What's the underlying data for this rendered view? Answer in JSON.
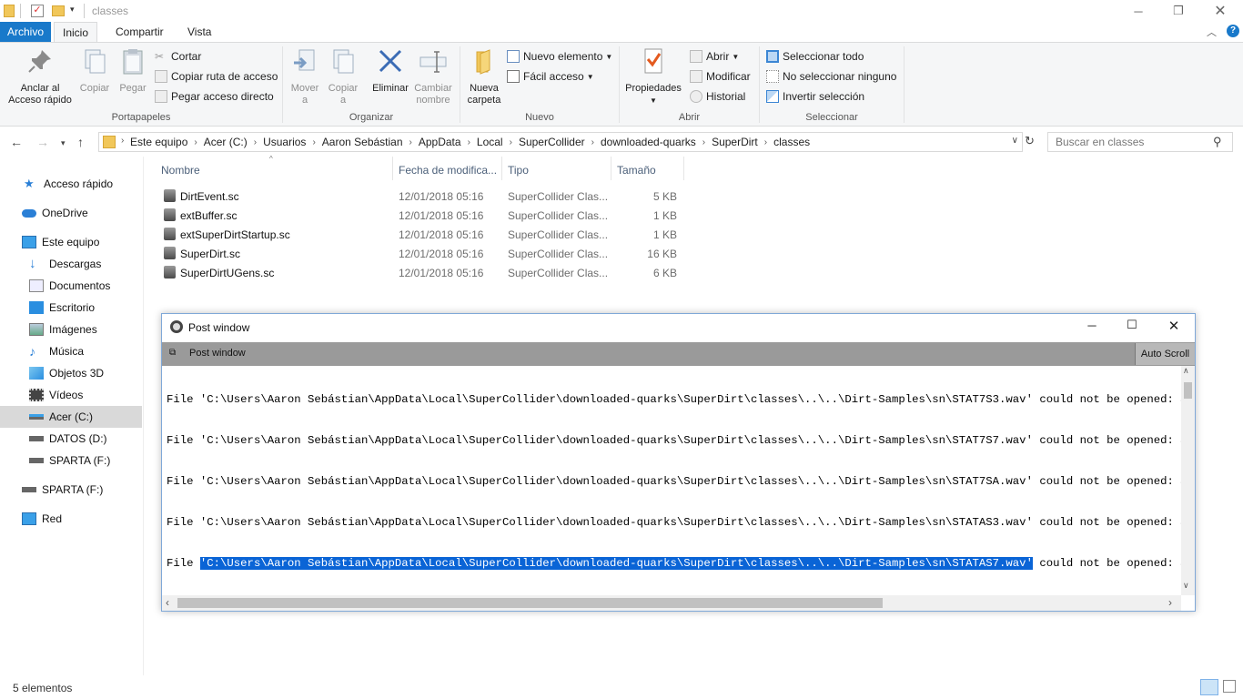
{
  "window": {
    "title": "classes"
  },
  "ribbon_tabs": [
    "Archivo",
    "Inicio",
    "Compartir",
    "Vista"
  ],
  "ribbon": {
    "portapapeles": {
      "label": "Portapapeles",
      "anclar": "Anclar al\nAcceso rápido",
      "copiar": "Copiar",
      "pegar": "Pegar",
      "cortar": "Cortar",
      "copiar_ruta": "Copiar ruta de acceso",
      "pegar_acceso": "Pegar acceso directo"
    },
    "organizar": {
      "label": "Organizar",
      "mover": "Mover\na",
      "copiar": "Copiar\na",
      "eliminar": "Eliminar",
      "cambiar": "Cambiar\nnombre"
    },
    "nuevo": {
      "label": "Nuevo",
      "nueva_carpeta": "Nueva\ncarpeta",
      "nuevo_elemento": "Nuevo elemento",
      "facil_acceso": "Fácil acceso"
    },
    "abrir": {
      "label": "Abrir",
      "propiedades": "Propiedades",
      "abrir": "Abrir",
      "modificar": "Modificar",
      "historial": "Historial"
    },
    "seleccionar": {
      "label": "Seleccionar",
      "todo": "Seleccionar todo",
      "ninguno": "No seleccionar ninguno",
      "invertir": "Invertir selección"
    }
  },
  "breadcrumb": [
    "Este equipo",
    "Acer (C:)",
    "Usuarios",
    "Aaron Sebástian",
    "AppData",
    "Local",
    "SuperCollider",
    "downloaded-quarks",
    "SuperDirt",
    "classes"
  ],
  "search": {
    "placeholder": "Buscar en classes"
  },
  "navpane": [
    {
      "label": "Acceso rápido",
      "icon": "star-icon"
    },
    {
      "label": "OneDrive",
      "icon": "cloud-icon"
    },
    {
      "label": "Este equipo",
      "icon": "computer-icon"
    },
    {
      "label": "Descargas",
      "icon": "download-icon"
    },
    {
      "label": "Documentos",
      "icon": "documents-icon"
    },
    {
      "label": "Escritorio",
      "icon": "desktop-icon"
    },
    {
      "label": "Imágenes",
      "icon": "images-icon"
    },
    {
      "label": "Música",
      "icon": "music-icon"
    },
    {
      "label": "Objetos 3D",
      "icon": "cube-icon"
    },
    {
      "label": "Vídeos",
      "icon": "video-icon"
    },
    {
      "label": "Acer (C:)",
      "icon": "drive-icon"
    },
    {
      "label": "DATOS (D:)",
      "icon": "drive-icon"
    },
    {
      "label": "SPARTA (F:)",
      "icon": "usb-drive-icon"
    },
    {
      "label": "SPARTA (F:)",
      "icon": "usb-drive-icon"
    },
    {
      "label": "Red",
      "icon": "network-icon"
    }
  ],
  "columns": {
    "name": "Nombre",
    "date": "Fecha de modifica...",
    "type": "Tipo",
    "size": "Tamaño"
  },
  "files": [
    {
      "name": "DirtEvent.sc",
      "date": "12/01/2018 05:16",
      "type": "SuperCollider Clas...",
      "size": "5 KB"
    },
    {
      "name": "extBuffer.sc",
      "date": "12/01/2018 05:16",
      "type": "SuperCollider Clas...",
      "size": "1 KB"
    },
    {
      "name": "extSuperDirtStartup.sc",
      "date": "12/01/2018 05:16",
      "type": "SuperCollider Clas...",
      "size": "1 KB"
    },
    {
      "name": "SuperDirt.sc",
      "date": "12/01/2018 05:16",
      "type": "SuperCollider Clas...",
      "size": "16 KB"
    },
    {
      "name": "SuperDirtUGens.sc",
      "date": "12/01/2018 05:16",
      "type": "SuperCollider Clas...",
      "size": "6 KB"
    }
  ],
  "post_window": {
    "title": "Post window",
    "toolbar_label": "Post window",
    "auto_scroll": "Auto Scroll",
    "lines": [
      {
        "pre": "File ",
        "path": "'C:\\Users\\Aaron Sebástian\\AppData\\Local\\SuperCollider\\downloaded-quarks\\SuperDirt\\classes\\..\\..\\Dirt-Samples\\sn\\STAT7S3.wav'",
        "post": " could not be opened: System e"
      },
      {
        "pre": "File ",
        "path": "'C:\\Users\\Aaron Sebástian\\AppData\\Local\\SuperCollider\\downloaded-quarks\\SuperDirt\\classes\\..\\..\\Dirt-Samples\\sn\\STAT7S7.wav'",
        "post": " could not be opened: System e"
      },
      {
        "pre": "File ",
        "path": "'C:\\Users\\Aaron Sebástian\\AppData\\Local\\SuperCollider\\downloaded-quarks\\SuperDirt\\classes\\..\\..\\Dirt-Samples\\sn\\STAT7SA.wav'",
        "post": " could not be opened: System e"
      },
      {
        "pre": "File ",
        "path": "'C:\\Users\\Aaron Sebástian\\AppData\\Local\\SuperCollider\\downloaded-quarks\\SuperDirt\\classes\\..\\..\\Dirt-Samples\\sn\\STATAS3.wav'",
        "post": " could not be opened: System e"
      },
      {
        "pre": "File ",
        "path": "'C:\\Users\\Aaron Sebástian\\AppData\\Local\\SuperCollider\\downloaded-quarks\\SuperDirt\\classes\\..\\..\\Dirt-Samples\\sn\\STATAS7.wav'",
        "post": " could not be opened: System e"
      }
    ]
  },
  "status": {
    "count": "5 elementos"
  },
  "colors": {
    "accent": "#1979ca",
    "selection": "#0a64d6",
    "toolbar_gray": "#9a9a9a"
  }
}
